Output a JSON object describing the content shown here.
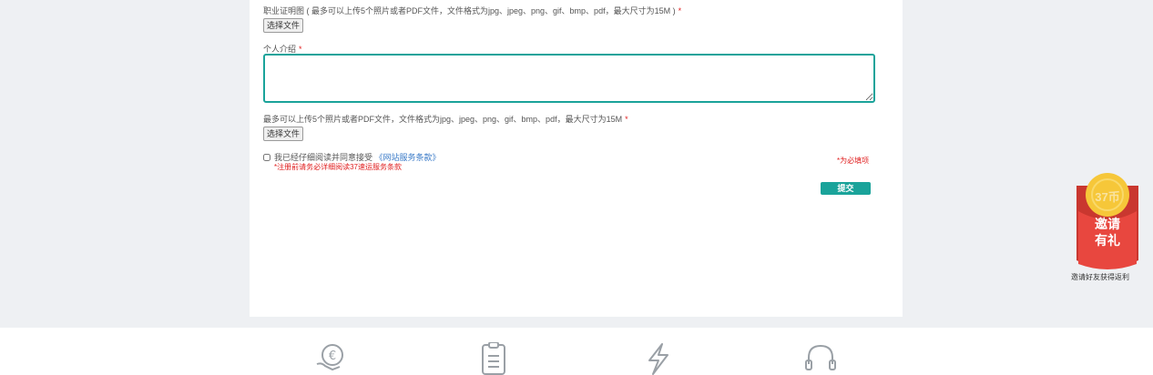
{
  "form": {
    "cert_label": "职业证明图 ( 最多可以上传5个照片或者PDF文件，文件格式为jpg、jpeg、png、gif、bmp、pdf，最大尺寸为15M )",
    "required_mark": "*",
    "choose_file": "选择文件",
    "intro_label": "个人介绍",
    "upload_hint": "最多可以上传5个照片或者PDF文件，文件格式为jpg、jpeg、png、gif、bmp、pdf，最大尺寸为15M",
    "agree_text": "我已经仔细阅读并同意接受",
    "terms_link": "《网站服务条款》",
    "agree_note": "*注册前请务必详细阅读37速运服务条款",
    "required_note": "*为必填项",
    "submit": "提交"
  },
  "invite": {
    "coin_text": "37币",
    "line1": "邀请",
    "line2": "有礼",
    "caption": "邀请好友获得返利"
  },
  "footer": {
    "icons": [
      "euro-coin-hand-icon",
      "clipboard-list-icon",
      "lightning-icon",
      "headset-icon"
    ]
  },
  "colors": {
    "accent": "#1aa39a",
    "required": "#e02020",
    "link": "#3b7bc8",
    "invite_red": "#e8473f",
    "coin_gold": "#f6c739"
  }
}
